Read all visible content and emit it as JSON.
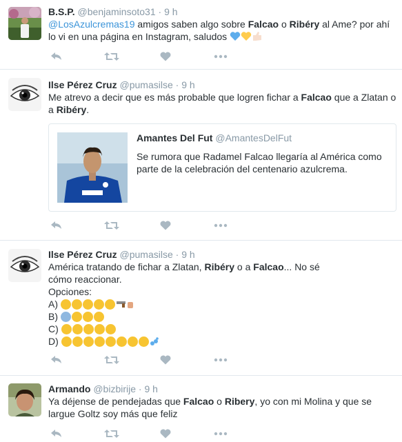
{
  "tweets": [
    {
      "fullname": "B.S.P.",
      "handle": "@benjaminsoto31",
      "time": "9 h",
      "mention": "@LosAzulcremas19",
      "text_a": " amigos saben algo sobre ",
      "b1": "Falcao",
      "text_b": " o ",
      "b2": "Ribéry",
      "text_c": " al Ame? por ahí lo vi en una página en Instagram, saludos"
    },
    {
      "fullname": "Ilse Pérez Cruz",
      "handle": "@pumasilse",
      "time": "9 h",
      "text_a": "Me atrevo a decir que es más probable que logren fichar a ",
      "b1": "Falcao",
      "text_b": " que a Zlatan o a ",
      "b2": "Ribéry",
      "text_c": ".",
      "quote": {
        "fullname": "Amantes Del Fut",
        "handle": "@AmantesDelFut",
        "text": "Se rumora que Radamel Falcao llegaría al América como parte de la celebración del centenario azulcrema."
      }
    },
    {
      "fullname": "Ilse Pérez Cruz",
      "handle": "@pumasilse",
      "time": "9 h",
      "text_a": "América tratando de fichar a Zlatan, ",
      "b1": "Ribéry",
      "text_b": " o a ",
      "b2": "Falcao",
      "text_c": "... No sé cómo reaccionar.",
      "options_label": "Opciones:",
      "options": [
        "A)",
        "B)",
        "C)",
        "D)"
      ]
    },
    {
      "fullname": "Armando",
      "handle": "@bizbirije",
      "time": "9 h",
      "text_a": "Ya déjense de pendejadas que ",
      "b1": "Falcao",
      "text_b": " o ",
      "b2": "Ribery",
      "text_c": ", yo con mi Molina y que se largue Goltz soy más que feliz"
    }
  ],
  "sep": "·",
  "colors": {
    "link": "#3b94d9",
    "muted": "#8899a6",
    "icon": "#aab8c2",
    "border": "#e1e8ed"
  },
  "icons": [
    "reply-icon",
    "retweet-icon",
    "like-icon",
    "more-icon"
  ]
}
